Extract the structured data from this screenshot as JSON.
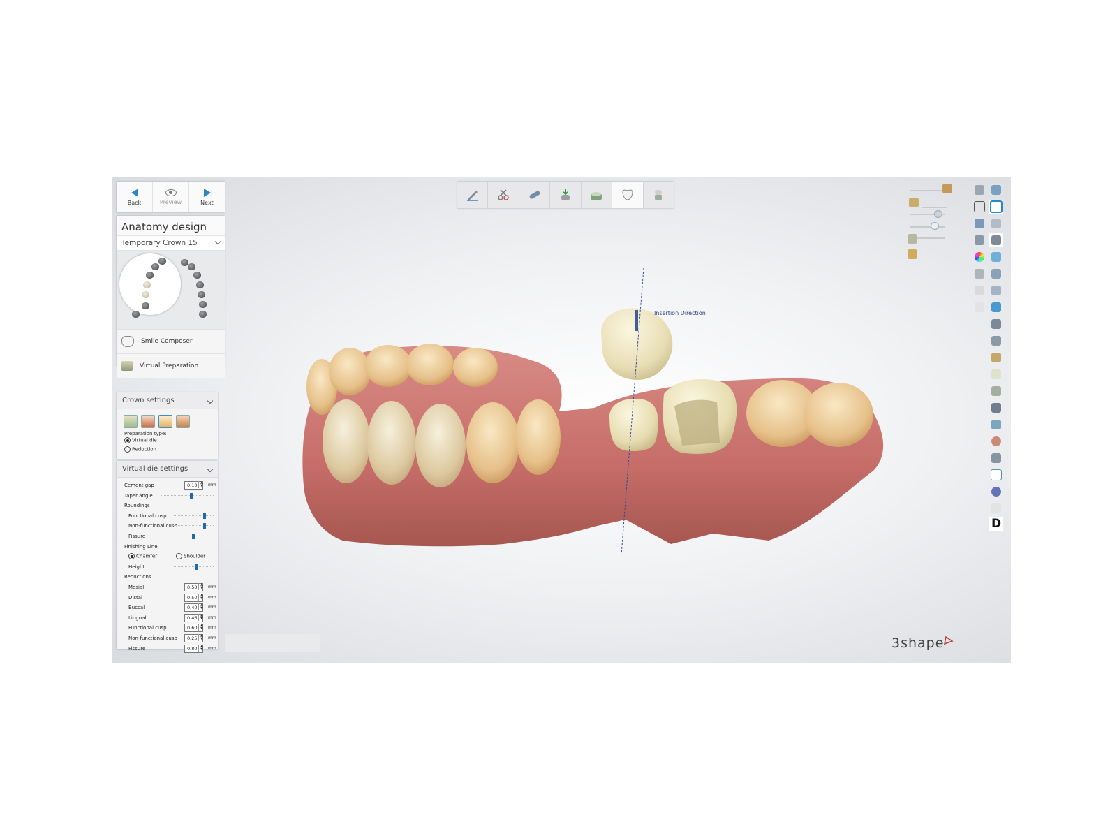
{
  "nav": {
    "back": "Back",
    "preview": "Preview",
    "next": "Next"
  },
  "design": {
    "title": "Anatomy design",
    "selected_tooth": "Temporary Crown 15",
    "smile_composer": "Smile Composer",
    "virtual_preparation": "Virtual Preparation"
  },
  "crown_settings": {
    "title": "Crown settings",
    "prep_type_label": "Preparation type:",
    "option_virtual_die": "Virtual die",
    "option_reduction": "Reduction",
    "selected": "Virtual die"
  },
  "virtual_die": {
    "title": "Virtual die settings",
    "cement_gap": {
      "label": "Cement gap",
      "value": "0.10",
      "unit": "mm"
    },
    "taper_angle": {
      "label": "Taper angle",
      "level": 0.55
    },
    "roundings_label": "Roundings",
    "functional_cusp": {
      "label": "Functional cusp",
      "level": 0.88
    },
    "non_functional_cusp": {
      "label": "Non-functional cusp",
      "level": 0.88
    },
    "fissure_round": {
      "label": "Fissure",
      "level": 0.55
    },
    "finishing_line_label": "Finishing Line",
    "chamfer": "Chamfer",
    "shoulder": "Shoulder",
    "finish_selected": "Chamfer",
    "height": {
      "label": "Height",
      "level": 0.7
    },
    "reductions_label": "Reductions",
    "reductions": [
      {
        "label": "Mesial",
        "value": "0.50",
        "unit": "mm"
      },
      {
        "label": "Distal",
        "value": "0.50",
        "unit": "mm"
      },
      {
        "label": "Buccal",
        "value": "0.40",
        "unit": "mm"
      },
      {
        "label": "Lingual",
        "value": "0.46",
        "unit": "mm"
      },
      {
        "label": "Functional cusp",
        "value": "0.60",
        "unit": "mm"
      },
      {
        "label": "Non-functional cusp",
        "value": "0.25",
        "unit": "mm"
      },
      {
        "label": "Fissure",
        "value": "0.80",
        "unit": "mm"
      }
    ]
  },
  "viewport": {
    "insertion_label": "Insertion Direction"
  },
  "logo": "3shape",
  "colors": {
    "accent": "#2a87c6",
    "gum": "#c9716d",
    "tooth": "#e9dcb8"
  }
}
